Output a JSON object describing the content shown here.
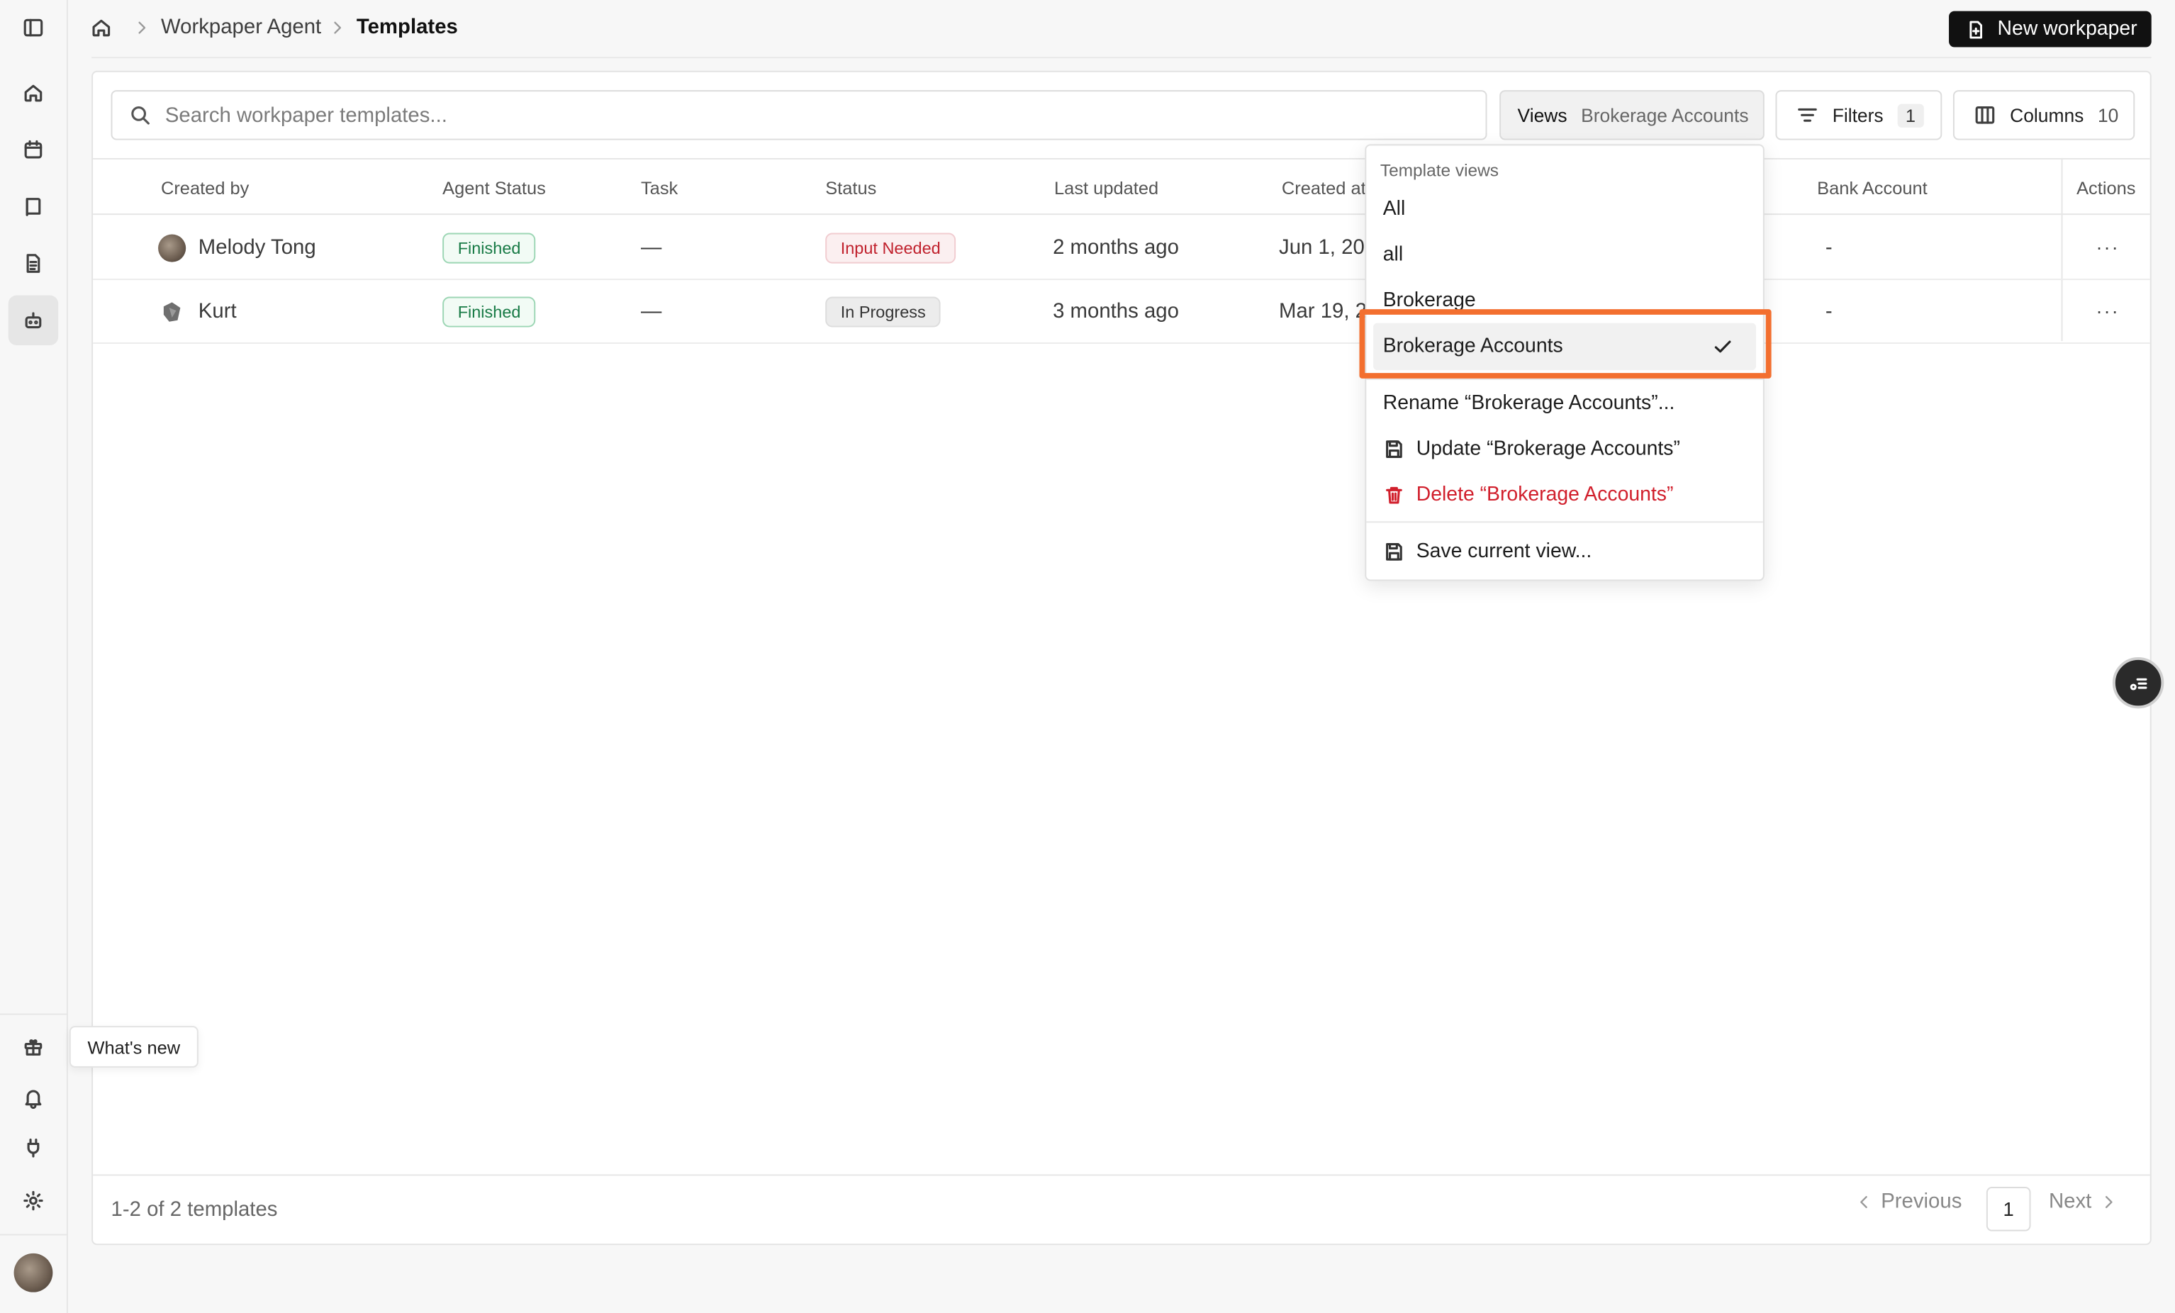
{
  "breadcrumb": {
    "section": "Workpaper Agent",
    "current": "Templates"
  },
  "header": {
    "new_button": "New workpaper"
  },
  "search": {
    "placeholder": "Search workpaper templates..."
  },
  "toolbar": {
    "views_label": "Views",
    "views_value": "Brokerage Accounts",
    "filters_label": "Filters",
    "filters_count": "1",
    "columns_label": "Columns",
    "columns_count": "10"
  },
  "table": {
    "columns": [
      "Created by",
      "Agent Status",
      "Task",
      "Status",
      "Last updated",
      "Created at",
      "Bank Account",
      "Actions"
    ],
    "rows": [
      {
        "created_by": "Melody Tong",
        "agent_status": "Finished",
        "task": "—",
        "status": "Input Needed",
        "last_updated": "2 months ago",
        "created_at": "Jun 1, 20",
        "bank_account": "-",
        "actions": "···"
      },
      {
        "created_by": "Kurt",
        "agent_status": "Finished",
        "task": "—",
        "status": "In Progress",
        "last_updated": "3 months ago",
        "created_at": "Mar 19, 2",
        "bank_account": "-",
        "actions": "···"
      }
    ]
  },
  "footer": {
    "summary": "1-2 of 2 templates",
    "previous": "Previous",
    "page": "1",
    "next": "Next"
  },
  "dropdown": {
    "heading": "Template views",
    "views": [
      "All",
      "all",
      "Brokerage",
      "Brokerage Accounts"
    ],
    "selected": "Brokerage Accounts",
    "rename": "Rename “Brokerage Accounts”...",
    "update": "Update “Brokerage Accounts”",
    "delete": "Delete “Brokerage Accounts”",
    "save": "Save current view..."
  },
  "tooltip": {
    "whats_new": "What's new"
  },
  "colors": {
    "accent_highlight": "#f36f2f",
    "danger": "#d11f2c",
    "success": "#177a45",
    "primary_button": "#111111"
  }
}
